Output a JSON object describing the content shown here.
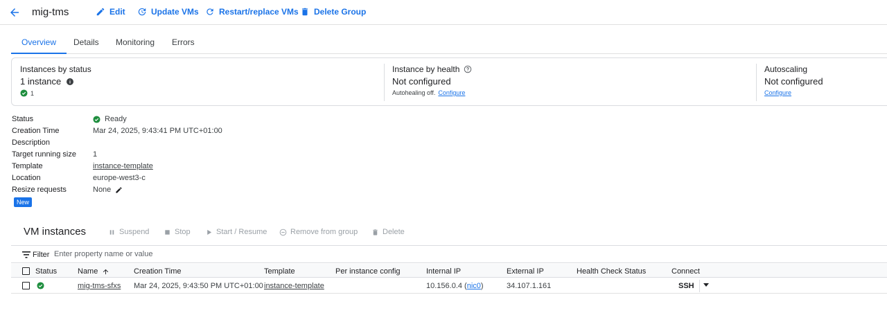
{
  "header": {
    "title": "mig-tms",
    "buttons": {
      "edit": "Edit",
      "update_vms": "Update VMs",
      "restart_replace": "Restart/replace VMs",
      "delete_group": "Delete Group"
    }
  },
  "tabs": [
    "Overview",
    "Details",
    "Monitoring",
    "Errors"
  ],
  "summary": {
    "status": {
      "title": "Instances by status",
      "value": "1 instance",
      "ready_count": "1"
    },
    "health": {
      "title": "Instance by health",
      "value": "Not configured",
      "sub_text": "Autohealing off.",
      "sub_link": "Configure"
    },
    "autoscaling": {
      "title": "Autoscaling",
      "value": "Not configured",
      "link": "Configure"
    }
  },
  "properties": {
    "status_label": "Status",
    "status_value": "Ready",
    "creation_label": "Creation Time",
    "creation_value": "Mar 24, 2025, 9:43:41 PM UTC+01:00",
    "description_label": "Description",
    "target_label": "Target running size",
    "target_value": "1",
    "template_label": "Template",
    "template_value": "instance-template",
    "location_label": "Location",
    "location_value": "europe-west3-c",
    "resize_label": "Resize requests",
    "resize_value": "None",
    "new_badge": "New"
  },
  "vm_instances": {
    "title": "VM instances",
    "actions": {
      "suspend": "Suspend",
      "stop": "Stop",
      "start_resume": "Start / Resume",
      "remove_from_group": "Remove from group",
      "delete": "Delete"
    },
    "filter": {
      "label": "Filter",
      "placeholder": "Enter property name or value"
    },
    "columns": {
      "status": "Status",
      "name": "Name",
      "creation_time": "Creation Time",
      "template": "Template",
      "per_instance_config": "Per instance config",
      "internal_ip": "Internal IP",
      "external_ip": "External IP",
      "health_check_status": "Health Check Status",
      "connect": "Connect"
    },
    "rows": [
      {
        "name": "mig-tms-sfxs",
        "creation_time": "Mar 24, 2025, 9:43:50 PM UTC+01:00",
        "template": "instance-template",
        "per_instance_config": "",
        "internal_ip": "10.156.0.4",
        "nic": "nic0",
        "external_ip": "34.107.1.161",
        "health_check_status": "",
        "connect": "SSH"
      }
    ]
  },
  "colors": {
    "accent": "#1a73e8",
    "success": "#1e8e3e",
    "disabled": "#9aa0a6"
  }
}
